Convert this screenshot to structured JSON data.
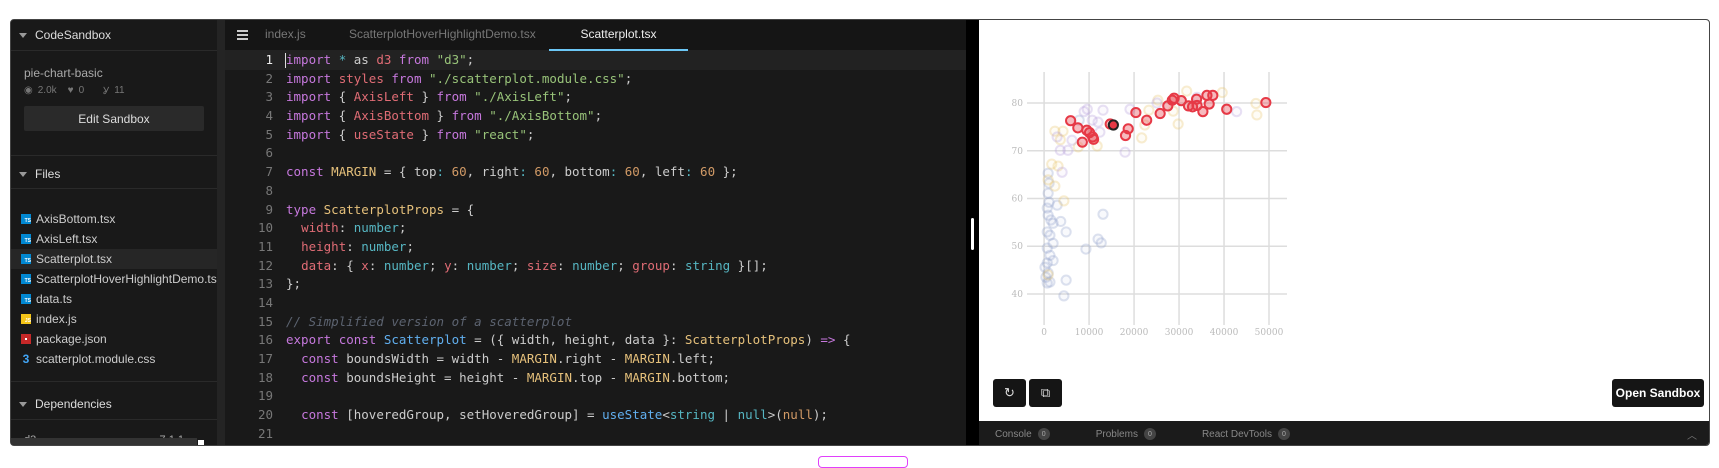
{
  "sidebar": {
    "title": "CodeSandbox",
    "project": "pie-chart-basic",
    "views": "2.0k",
    "likes": "0",
    "forks": "11",
    "edit_button": "Edit Sandbox",
    "files_title": "Files",
    "files": [
      {
        "name": "AxisBottom.tsx",
        "type": "ts"
      },
      {
        "name": "AxisLeft.tsx",
        "type": "ts"
      },
      {
        "name": "Scatterplot.tsx",
        "type": "ts",
        "selected": true
      },
      {
        "name": "ScatterplotHoverHighlightDemo.tsx",
        "type": "ts"
      },
      {
        "name": "data.ts",
        "type": "ts"
      },
      {
        "name": "index.js",
        "type": "js"
      },
      {
        "name": "package.json",
        "type": "json"
      },
      {
        "name": "scatterplot.module.css",
        "type": "css"
      }
    ],
    "dependencies_title": "Dependencies",
    "dependency_partial": {
      "name": "d3",
      "version": "7.1.1"
    }
  },
  "editor": {
    "tabs": [
      "index.js",
      "ScatterplotHoverHighlightDemo.tsx",
      "Scatterplot.tsx"
    ],
    "active_tab": 2,
    "current_line": 1,
    "lines": [
      [
        [
          "import",
          "k"
        ],
        [
          " ",
          ""
        ],
        [
          "*",
          "o"
        ],
        [
          " as ",
          ""
        ],
        [
          "d3",
          "r"
        ],
        [
          " ",
          ""
        ],
        [
          "from",
          "k"
        ],
        [
          " ",
          ""
        ],
        [
          "\"d3\"",
          "s"
        ],
        [
          ";",
          ""
        ]
      ],
      [
        [
          "import",
          "k"
        ],
        [
          " ",
          ""
        ],
        [
          "styles",
          "r"
        ],
        [
          " ",
          ""
        ],
        [
          "from",
          "k"
        ],
        [
          " ",
          ""
        ],
        [
          "\"./scatterplot.module.css\"",
          "s"
        ],
        [
          ";",
          ""
        ]
      ],
      [
        [
          "import",
          "k"
        ],
        [
          " { ",
          ""
        ],
        [
          "AxisLeft",
          "r"
        ],
        [
          " } ",
          ""
        ],
        [
          "from",
          "k"
        ],
        [
          " ",
          ""
        ],
        [
          "\"./AxisLeft\"",
          "s"
        ],
        [
          ";",
          ""
        ]
      ],
      [
        [
          "import",
          "k"
        ],
        [
          " { ",
          ""
        ],
        [
          "AxisBottom",
          "r"
        ],
        [
          " } ",
          ""
        ],
        [
          "from",
          "k"
        ],
        [
          " ",
          ""
        ],
        [
          "\"./AxisBottom\"",
          "s"
        ],
        [
          ";",
          ""
        ]
      ],
      [
        [
          "import",
          "k"
        ],
        [
          " { ",
          ""
        ],
        [
          "useState",
          "r"
        ],
        [
          " } ",
          ""
        ],
        [
          "from",
          "k"
        ],
        [
          " ",
          ""
        ],
        [
          "\"react\"",
          "s"
        ],
        [
          ";",
          ""
        ]
      ],
      [],
      [
        [
          "const",
          "k"
        ],
        [
          " ",
          ""
        ],
        [
          "MARGIN",
          "y"
        ],
        [
          " = { top",
          ""
        ],
        [
          ":",
          "c"
        ],
        [
          " ",
          ""
        ],
        [
          "60",
          "n"
        ],
        [
          ", right",
          ""
        ],
        [
          ":",
          "c"
        ],
        [
          " ",
          ""
        ],
        [
          "60",
          "n"
        ],
        [
          ", bottom",
          ""
        ],
        [
          ":",
          "c"
        ],
        [
          " ",
          ""
        ],
        [
          "60",
          "n"
        ],
        [
          ", left",
          ""
        ],
        [
          ":",
          "c"
        ],
        [
          " ",
          ""
        ],
        [
          "60",
          "n"
        ],
        [
          " };",
          ""
        ]
      ],
      [],
      [
        [
          "type",
          "k"
        ],
        [
          " ",
          ""
        ],
        [
          "ScatterplotProps",
          "y"
        ],
        [
          " = {",
          ""
        ]
      ],
      [
        [
          "  ",
          ""
        ],
        [
          "width",
          "r"
        ],
        [
          ": ",
          ""
        ],
        [
          "number",
          "c"
        ],
        [
          ";",
          ""
        ]
      ],
      [
        [
          "  ",
          ""
        ],
        [
          "height",
          "r"
        ],
        [
          ": ",
          ""
        ],
        [
          "number",
          "c"
        ],
        [
          ";",
          ""
        ]
      ],
      [
        [
          "  ",
          ""
        ],
        [
          "data",
          "r"
        ],
        [
          ": { ",
          ""
        ],
        [
          "x",
          "r"
        ],
        [
          ": ",
          ""
        ],
        [
          "number",
          "c"
        ],
        [
          "; ",
          ""
        ],
        [
          "y",
          "r"
        ],
        [
          ": ",
          ""
        ],
        [
          "number",
          "c"
        ],
        [
          "; ",
          ""
        ],
        [
          "size",
          "r"
        ],
        [
          ": ",
          ""
        ],
        [
          "number",
          "c"
        ],
        [
          "; ",
          ""
        ],
        [
          "group",
          "r"
        ],
        [
          ": ",
          ""
        ],
        [
          "string",
          "c"
        ],
        [
          " }[];",
          ""
        ]
      ],
      [
        [
          "};",
          ""
        ]
      ],
      [],
      [
        [
          "// Simplified version of a scatterplot",
          "cm"
        ]
      ],
      [
        [
          "export",
          "k"
        ],
        [
          " ",
          ""
        ],
        [
          "const",
          "k"
        ],
        [
          " ",
          ""
        ],
        [
          "Scatterplot",
          "f"
        ],
        [
          " = ({ width, height, data }: ",
          ""
        ],
        [
          "ScatterplotProps",
          "y"
        ],
        [
          ") ",
          ""
        ],
        [
          "=>",
          "k"
        ],
        [
          " {",
          ""
        ]
      ],
      [
        [
          "  ",
          ""
        ],
        [
          "const",
          "k"
        ],
        [
          " boundsWidth = width - ",
          ""
        ],
        [
          "MARGIN",
          "y"
        ],
        [
          ".right - ",
          ""
        ],
        [
          "MARGIN",
          "y"
        ],
        [
          ".left;",
          ""
        ]
      ],
      [
        [
          "  ",
          ""
        ],
        [
          "const",
          "k"
        ],
        [
          " boundsHeight = height - ",
          ""
        ],
        [
          "MARGIN",
          "y"
        ],
        [
          ".top - ",
          ""
        ],
        [
          "MARGIN",
          "y"
        ],
        [
          ".bottom;",
          ""
        ]
      ],
      [],
      [
        [
          "  ",
          ""
        ],
        [
          "const",
          "k"
        ],
        [
          " [hoveredGroup, setHoveredGroup] = ",
          ""
        ],
        [
          "useState",
          "f"
        ],
        [
          "<",
          ""
        ],
        [
          "string",
          "c"
        ],
        [
          " | ",
          ""
        ],
        [
          "null",
          "c"
        ],
        [
          ">(",
          ""
        ],
        [
          "null",
          "n"
        ],
        [
          ");",
          ""
        ]
      ],
      []
    ]
  },
  "preview": {
    "refresh_icon": "refresh-icon",
    "open_new_window_icon": "external-link-icon",
    "open_sandbox": "Open Sandbox",
    "bottom_tabs": [
      {
        "label": "Console",
        "count": "0"
      },
      {
        "label": "Problems",
        "count": "0"
      },
      {
        "label": "React DevTools",
        "count": "0"
      }
    ]
  },
  "chart_data": {
    "type": "scatter",
    "title": "",
    "xlabel": "",
    "ylabel": "",
    "xlim": [
      -3800,
      54000
    ],
    "ylim": [
      33.5,
      86.5
    ],
    "x_ticks": [
      0,
      10000,
      20000,
      30000,
      40000,
      50000
    ],
    "x_tick_labels": [
      "0",
      "10000",
      "20000",
      "30000",
      "40000",
      "50000"
    ],
    "y_ticks": [
      40,
      50,
      60,
      70,
      80
    ],
    "y_tick_labels": [
      "40",
      "50",
      "60",
      "70",
      "80"
    ],
    "grid": true,
    "highlighted_group": "red",
    "hovered_point": [
      15400,
      75.4
    ],
    "colors": {
      "red": "#e63946",
      "blue": "#8da0cb",
      "yellow": "#e9c46a",
      "purple": "#b39ddb"
    },
    "series": [
      {
        "name": "blue",
        "points": [
          [
            900,
            65.3
          ],
          [
            1100,
            63.2
          ],
          [
            900,
            61.1
          ],
          [
            1100,
            59.2
          ],
          [
            700,
            58
          ],
          [
            2900,
            58.6
          ],
          [
            900,
            56.5
          ],
          [
            1500,
            55.5
          ],
          [
            2000,
            54.8
          ],
          [
            3700,
            55.2
          ],
          [
            700,
            53
          ],
          [
            1300,
            52.3
          ],
          [
            4900,
            53
          ],
          [
            2000,
            50.6
          ],
          [
            700,
            49.6
          ],
          [
            1300,
            48.1
          ],
          [
            2000,
            47
          ],
          [
            700,
            46.5
          ],
          [
            200,
            45.6
          ],
          [
            900,
            44.4
          ],
          [
            400,
            43.5
          ],
          [
            1300,
            42.5
          ],
          [
            700,
            42.3
          ],
          [
            4900,
            42.9
          ],
          [
            4400,
            39.6
          ],
          [
            9300,
            49.4
          ],
          [
            12000,
            51.5
          ],
          [
            12700,
            50.7
          ],
          [
            13100,
            56.7
          ],
          [
            7800,
            76.4
          ]
        ]
      },
      {
        "name": "yellow",
        "points": [
          [
            1700,
            67.2
          ],
          [
            3100,
            66.8
          ],
          [
            2400,
            62.6
          ],
          [
            4400,
            59.5
          ],
          [
            900,
            63.9
          ],
          [
            2400,
            74.1
          ],
          [
            4200,
            74.1
          ],
          [
            3600,
            72.3
          ],
          [
            7600,
            70.8
          ],
          [
            11800,
            71
          ],
          [
            21700,
            72.7
          ],
          [
            22400,
            75.4
          ],
          [
            23300,
            78.5
          ],
          [
            25300,
            80.6
          ],
          [
            900,
            44
          ],
          [
            31700,
            82.5
          ],
          [
            28700,
            78.3
          ],
          [
            29800,
            75.6
          ],
          [
            39600,
            82.2
          ],
          [
            47100,
            79.9
          ],
          [
            47300,
            77.5
          ]
        ]
      },
      {
        "name": "purple",
        "points": [
          [
            4000,
            65.5
          ],
          [
            3600,
            70.1
          ],
          [
            5300,
            70.1
          ],
          [
            6200,
            72.2
          ],
          [
            2900,
            72.9
          ],
          [
            8900,
            78.2
          ],
          [
            9600,
            78.7
          ],
          [
            13100,
            78.5
          ],
          [
            10700,
            76.4
          ],
          [
            12000,
            76
          ],
          [
            19100,
            78.7
          ],
          [
            18000,
            69.7
          ],
          [
            12400,
            73.9
          ],
          [
            25100,
            80
          ],
          [
            42800,
            78.2
          ],
          [
            34000,
            81.2
          ]
        ]
      },
      {
        "name": "red",
        "points": [
          [
            5900,
            76.3
          ],
          [
            7500,
            74.8
          ],
          [
            9500,
            74.3
          ],
          [
            10100,
            73.8
          ],
          [
            10800,
            72.9
          ],
          [
            11000,
            72.4
          ],
          [
            8500,
            71.8
          ],
          [
            14700,
            75.6
          ],
          [
            18700,
            74.6
          ],
          [
            18100,
            73.2
          ],
          [
            20400,
            78
          ],
          [
            22800,
            76.4
          ],
          [
            25800,
            77.8
          ],
          [
            27500,
            79.4
          ],
          [
            28500,
            80.6
          ],
          [
            28900,
            81
          ],
          [
            30500,
            80.5
          ],
          [
            32100,
            79.4
          ],
          [
            33000,
            79.2
          ],
          [
            33900,
            80.8
          ],
          [
            34000,
            79.5
          ],
          [
            35300,
            78.2
          ],
          [
            36200,
            81.6
          ],
          [
            37500,
            81.6
          ],
          [
            36700,
            79.8
          ],
          [
            40600,
            78.7
          ],
          [
            49300,
            80.1
          ],
          [
            15400,
            75.4
          ]
        ]
      }
    ]
  }
}
